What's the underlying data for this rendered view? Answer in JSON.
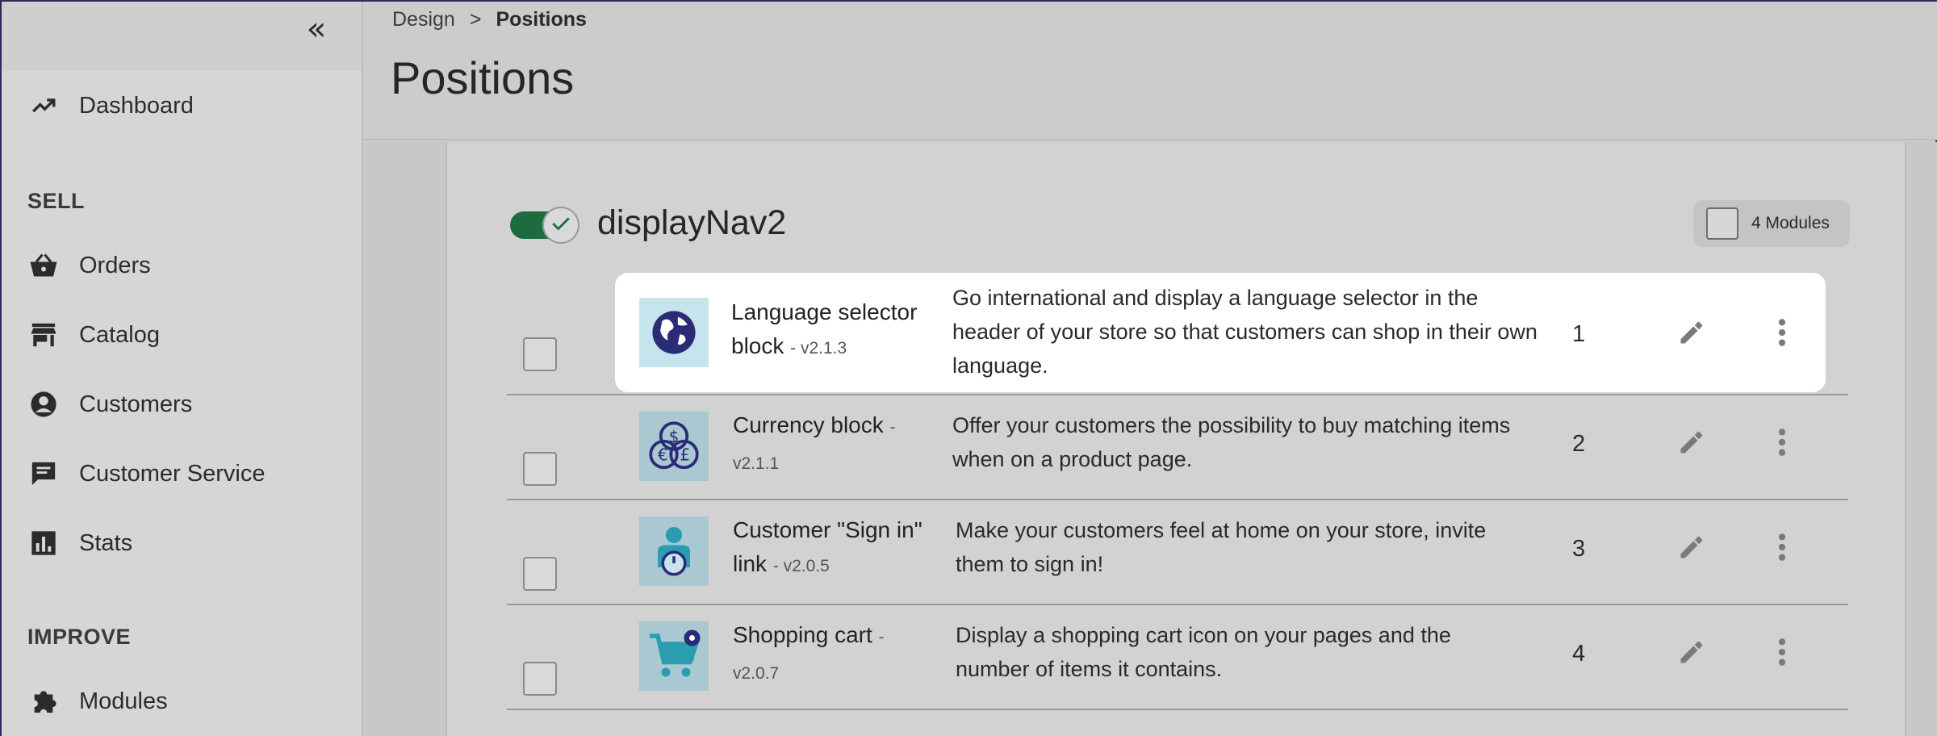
{
  "sidebar": {
    "collapse_label": "«",
    "dashboard": "Dashboard",
    "sections": [
      {
        "label": "SELL",
        "items": [
          "Orders",
          "Catalog",
          "Customers",
          "Customer Service",
          "Stats"
        ]
      },
      {
        "label": "IMPROVE",
        "items": [
          "Modules"
        ]
      }
    ]
  },
  "header": {
    "breadcrumb": [
      "Design",
      ">",
      "Positions"
    ],
    "title": "Positions"
  },
  "hook": {
    "name": "displayNav2",
    "enabled": true,
    "modules_count_label": "4 Modules"
  },
  "modules": [
    {
      "name": "Language selector block",
      "version": "- v2.1.3",
      "description": "Go international and display a language selector in the header of your store so that customers can shop in their own language.",
      "position": "1",
      "icon": "globe-icon"
    },
    {
      "name": "Currency block",
      "version": "- v2.1.1",
      "description": "Offer your customers the possibility to buy matching items when on a product page.",
      "position": "2",
      "icon": "currency-coins-icon"
    },
    {
      "name": "Customer \"Sign in\" link",
      "version": "- v2.0.5",
      "description": "Make your customers feel at home on your store, invite them to sign in!",
      "position": "3",
      "icon": "user-power-icon"
    },
    {
      "name": "Shopping cart",
      "version": "- v2.0.7",
      "description": "Display a shopping cart icon on your pages and the number of items it contains.",
      "position": "4",
      "icon": "shopping-cart-icon"
    }
  ],
  "colors": {
    "toggle_on": "#1e6b3f",
    "icon_bg": "#a9c8d2",
    "icon_navy": "#2b2b78",
    "icon_teal": "#2a9db0"
  }
}
